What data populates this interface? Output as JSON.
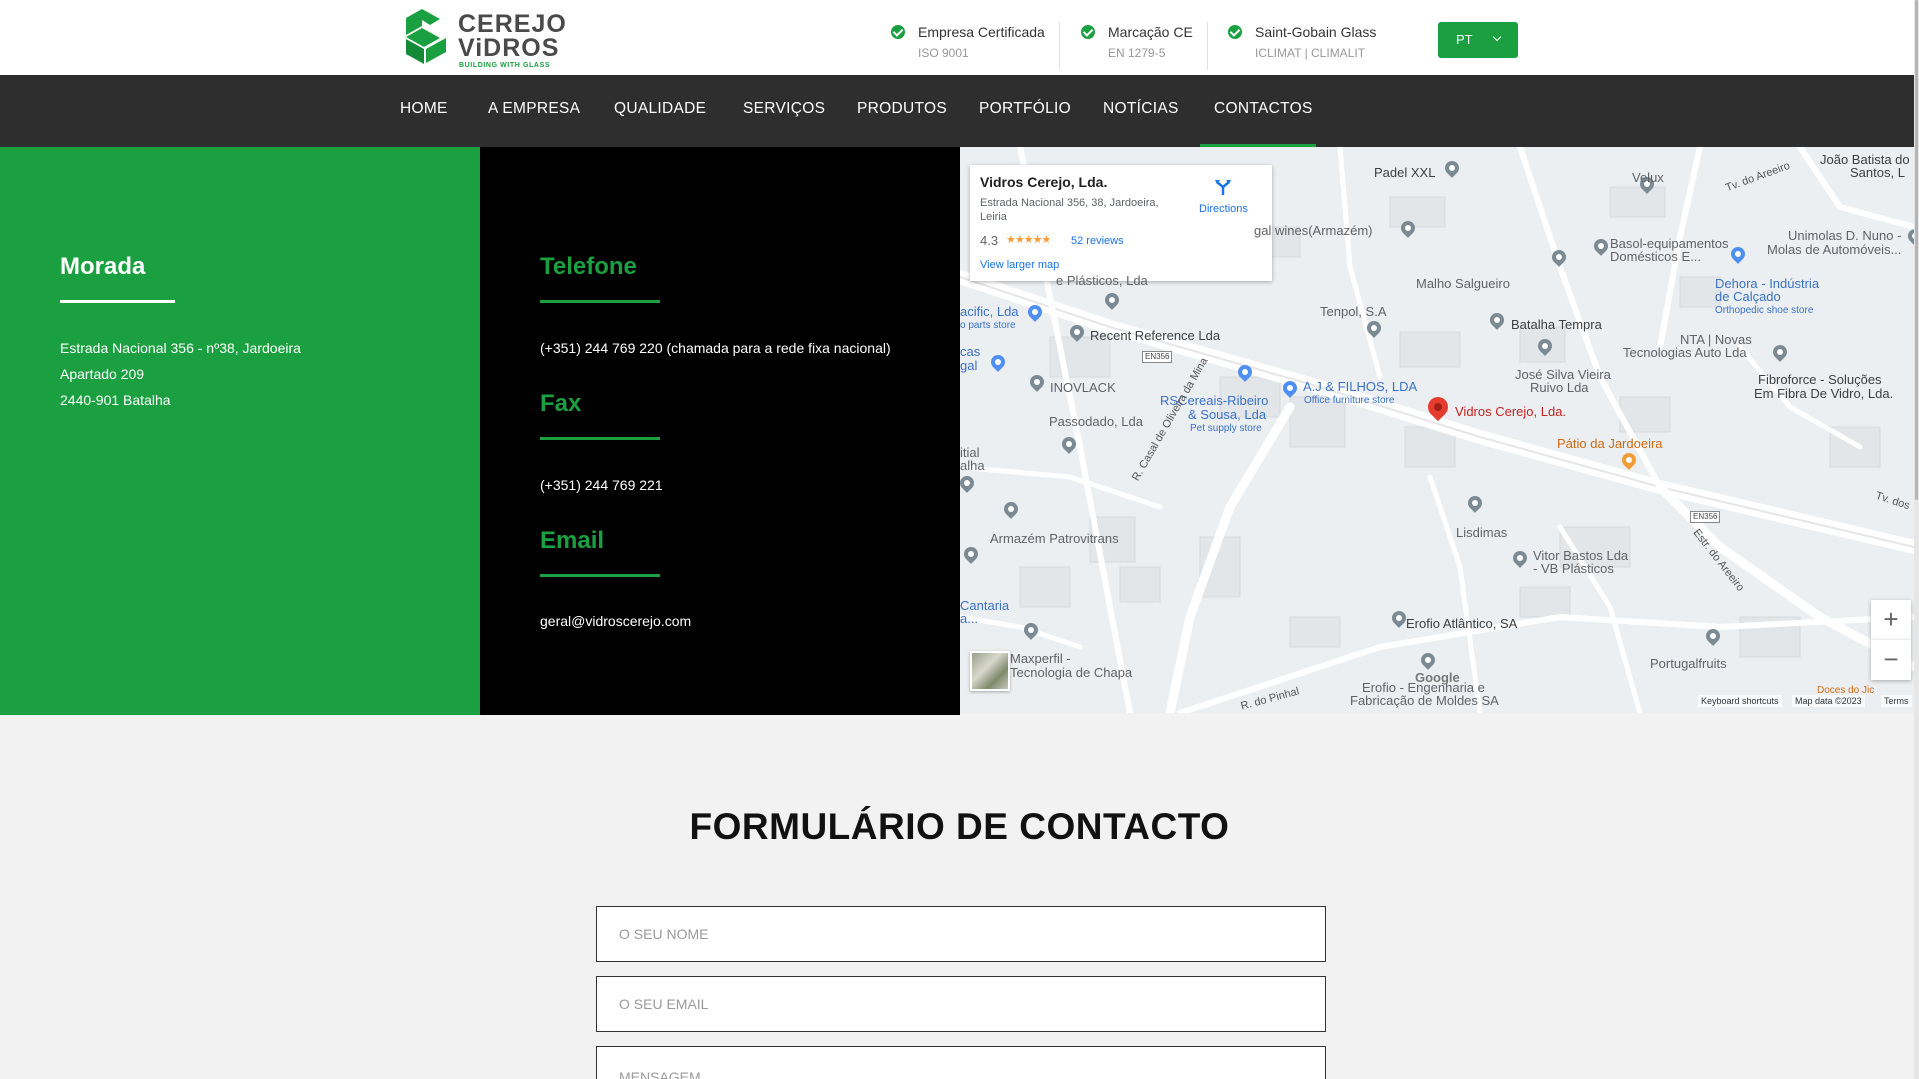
{
  "brand": {
    "name_line1": "CEREJO",
    "name_line2": "ViDROS",
    "tagline": "BUILDING WITH GLASS",
    "green": "#1aa040"
  },
  "certs": [
    {
      "title": "Empresa Certificada",
      "sub": "ISO 9001"
    },
    {
      "title": "Marcação CE",
      "sub": "EN 1279-5"
    },
    {
      "title": "Saint-Gobain Glass",
      "sub": "ICLIMAT | CLIMALIT"
    }
  ],
  "language": {
    "selected": "PT"
  },
  "nav": {
    "items": [
      "HOME",
      "A EMPRESA",
      "QUALIDADE",
      "SERVIÇOS",
      "PRODUTOS",
      "PORTFÓLIO",
      "NOTÍCIAS",
      "CONTACTOS"
    ],
    "active": "CONTACTOS"
  },
  "address": {
    "heading": "Morada",
    "line1": "Estrada Nacional 356 - nº38, Jardoeira",
    "line2": "Apartado 209",
    "line3": "2440-901 Batalha"
  },
  "contacts": {
    "phone_heading": "Telefone",
    "phone": "(+351) 244 769 220 (chamada para a rede fixa nacional)",
    "fax_heading": "Fax",
    "fax": "(+351) 244 769 221",
    "email_heading": "Email",
    "email": "geral@vidroscerejo.com"
  },
  "map": {
    "card": {
      "name": "Vidros Cerejo, Lda.",
      "address": "Estrada Nacional 356, 38, Jardoeira, Leiria",
      "rating": "4.3",
      "stars": "★★★★★",
      "reviews": "52 reviews",
      "larger": "View larger map",
      "directions": "Directions"
    },
    "places": {
      "padel": "Padel XXL",
      "velux": "Velux",
      "joao1": "João Batista do",
      "joao2": "Santos, L",
      "tvareeiro": "Tv. do Areeiro",
      "wines": "gal wines(Armazém)",
      "basol1": "Basol-equipamentos",
      "basol2": "Domésticos E...",
      "unimolas1": "Unimolas D. Nuno -",
      "unimolas2": "Molas de Automóveis...",
      "malho": "Malho Salgueiro",
      "dehora1": "Dehora - Indústria",
      "dehora2": "de Calçado",
      "dehora3": "Orthopedic shoe store",
      "pacific1": "acific, Lda",
      "pacific2": "o parts store",
      "plasticos": "e Plásticos, Lda",
      "tenpol": "Tenpol, S.A",
      "batalha": "Batalha Tempra",
      "nta1": "NTA | Novas",
      "nta2": "Tecnologias Auto Lda",
      "recent": "Recent Reference Lda",
      "en356a": "EN356",
      "cas1": "cas",
      "cas2": "gal",
      "fibro1": "Fibroforce - Soluções",
      "fibro2": "Em Fibra De Vidro, Lda.",
      "jose1": "José Silva Vieira",
      "jose2": "Ruivo Lda",
      "inovlack": "INOVLACK",
      "aj1": "A.J & FILHOS, LDA",
      "aj2": "Office furniture store",
      "rsc1": "RSCereais-Ribeiro",
      "rsc2": "& Sousa, Lda",
      "rsc3": "Pet supply store",
      "vidros": "Vidros Cerejo, Lda.",
      "passodado": "Passodado, Lda",
      "patio": "Pátio da Jardoeira",
      "itial": "itial",
      "alha": "alha",
      "casal": "R. Casal de Oliveira da Mina",
      "lisdimas": "Lisdimas",
      "en356b": "EN356",
      "tvdos": "Tv. dos",
      "armazem": "Armazém Patrovitrans",
      "areeiro": "Estr. do Areeiro",
      "vitor1": "Vitor Bastos Lda",
      "vitor2": "- VB Plásticos",
      "cantaria1": "Cantaria",
      "cantaria2": "a...",
      "erofio": "Erofio Atlântico, SA",
      "maxperfil1": "Maxperfil -",
      "maxperfil2": "Tecnologia de Chapa",
      "portugal": "Portugalfruits",
      "google": "Google",
      "erofio2a": "Erofio - Engenharia e",
      "erofio2b": "Fabricação de Moldes SA",
      "pinhal": "R. do Pinhal",
      "doces": "Doces do Jic"
    },
    "attribution": {
      "shortcuts": "Keyboard shortcuts",
      "data": "Map data ©2023",
      "terms": "Terms"
    }
  },
  "form": {
    "title": "FORMULÁRIO DE CONTACTO",
    "name_placeholder": "O SEU NOME",
    "email_placeholder": "O SEU EMAIL",
    "message_placeholder": "MENSAGEM"
  }
}
